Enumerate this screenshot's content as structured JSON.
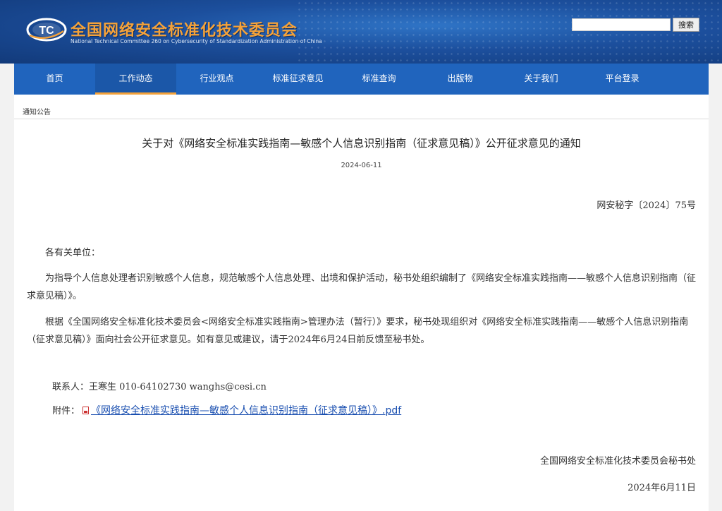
{
  "header": {
    "title": "全国网络安全标准化技术委员会",
    "subtitle": "National Technical Committee 260 on Cybersecurity of Standardization Administration of China",
    "logo_text": "TC",
    "search": {
      "value": "",
      "button_label": "搜索"
    }
  },
  "nav": {
    "items": [
      {
        "label": "首页"
      },
      {
        "label": "工作动态",
        "active": true
      },
      {
        "label": "行业观点"
      },
      {
        "label": "标准征求意见"
      },
      {
        "label": "标准查询"
      },
      {
        "label": "出版物"
      },
      {
        "label": "关于我们"
      },
      {
        "label": "平台登录"
      }
    ]
  },
  "breadcrumb": "通知公告",
  "article": {
    "title": "关于对《网络安全标准实践指南—敏感个人信息识别指南（征求意见稿）》公开征求意见的通知",
    "date": "2024-06-11",
    "doc_no": "网安秘字〔2024〕75号",
    "greeting": "各有关单位：",
    "para1": "为指导个人信息处理者识别敏感个人信息，规范敏感个人信息处理、出境和保护活动，秘书处组织编制了《网络安全标准实践指南——敏感个人信息识别指南（征求意见稿）》。",
    "para2": "根据《全国网络安全标准化技术委员会<网络安全标准实践指南>管理办法（暂行）》要求，秘书处现组织对《网络安全标准实践指南——敏感个人信息识别指南（征求意见稿）》面向社会公开征求意见。如有意见或建议，请于2024年6月24日前反馈至秘书处。",
    "contact": "联系人：王寒生  010-64102730  wanghs@cesi.cn",
    "attachment_label": "附件：",
    "attachment_link": "《网络安全标准实践指南—敏感个人信息识别指南（征求意见稿）》.pdf",
    "sign_org": "全国网络安全标准化技术委员会秘书处",
    "sign_date": "2024年6月11日"
  },
  "colors": {
    "banner": "#1c4f9d",
    "nav": "#2064bd",
    "accent": "#f4a23a",
    "link": "#1a4fb0"
  },
  "icons": {
    "logo": "tc260-logo-icon",
    "attachment": "pdf-file-icon"
  }
}
